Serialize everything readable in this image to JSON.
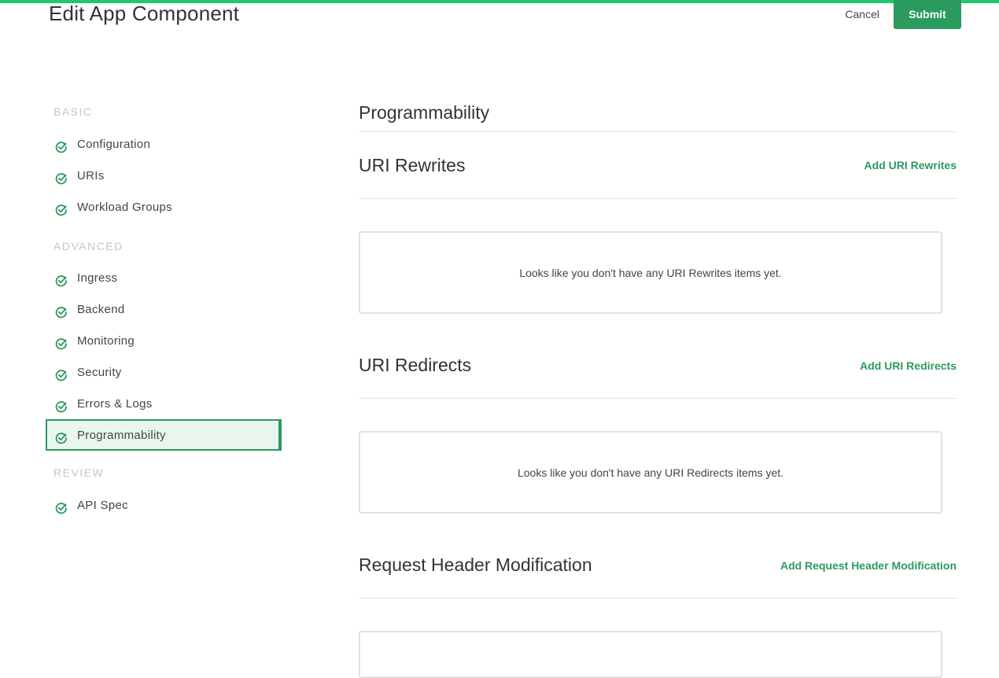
{
  "header": {
    "title": "Edit App Component",
    "cancel_label": "Cancel",
    "submit_label": "Submit"
  },
  "sidebar": {
    "sections": [
      {
        "heading": "BASIC",
        "items": [
          {
            "label": "Configuration",
            "icon": "check-circle-icon"
          },
          {
            "label": "URIs",
            "icon": "check-circle-icon"
          },
          {
            "label": "Workload Groups",
            "icon": "check-circle-icon"
          }
        ]
      },
      {
        "heading": "ADVANCED",
        "items": [
          {
            "label": "Ingress",
            "icon": "check-circle-icon"
          },
          {
            "label": "Backend",
            "icon": "check-circle-icon"
          },
          {
            "label": "Monitoring",
            "icon": "check-circle-icon"
          },
          {
            "label": "Security",
            "icon": "check-circle-icon"
          },
          {
            "label": "Errors & Logs",
            "icon": "check-circle-icon"
          },
          {
            "label": "Programmability",
            "icon": "check-circle-icon",
            "active": true
          }
        ]
      },
      {
        "heading": "REVIEW",
        "items": [
          {
            "label": "API Spec",
            "icon": "check-circle-icon"
          }
        ]
      }
    ]
  },
  "main": {
    "title": "Programmability",
    "blocks": [
      {
        "title": "URI Rewrites",
        "action_label": "Add URI Rewrites",
        "empty_text": "Looks like you don't have any URI Rewrites items yet."
      },
      {
        "title": "URI Redirects",
        "action_label": "Add URI Redirects",
        "empty_text": "Looks like you don't have any URI Redirects items yet."
      },
      {
        "title": "Request Header Modification",
        "action_label": "Add Request Header Modification",
        "empty_text": ""
      }
    ]
  },
  "colors": {
    "accent": "#2b9a5f",
    "top_bar": "#1ec86e",
    "active_bg": "#e9f6ee",
    "section_heading": "#c6c6c6"
  }
}
